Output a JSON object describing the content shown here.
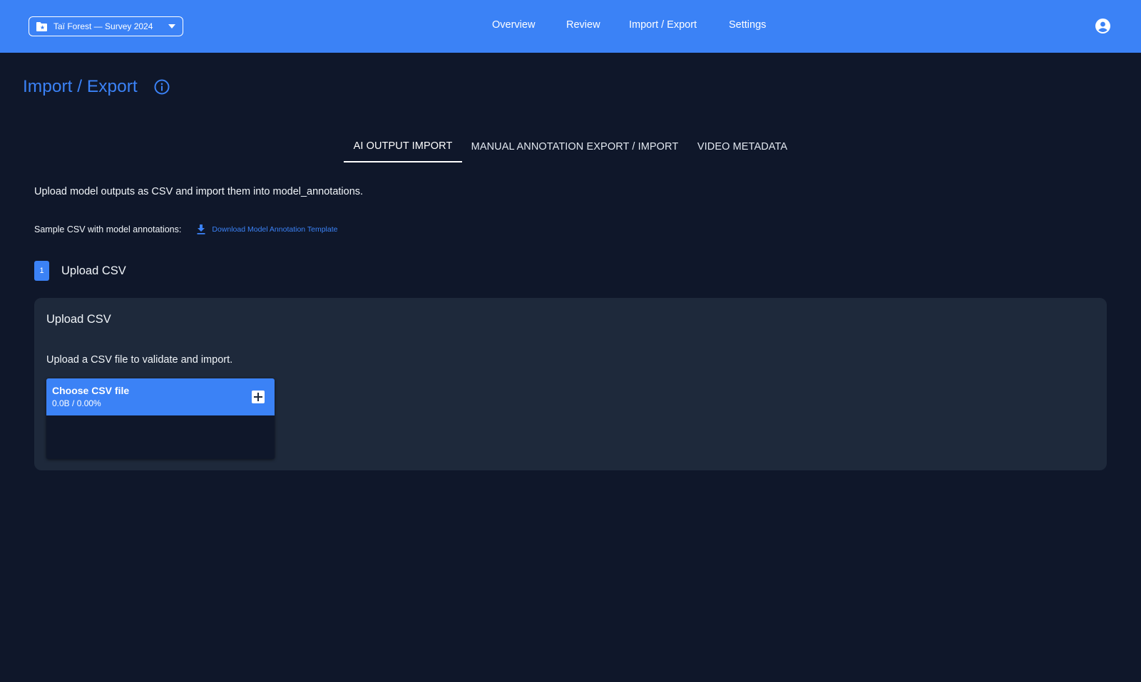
{
  "header": {
    "project_selector": {
      "label": "Taï Forest — Survey 2024"
    },
    "nav": [
      {
        "label": "Overview"
      },
      {
        "label": "Review"
      },
      {
        "label": "Import / Export"
      },
      {
        "label": "Settings"
      }
    ],
    "icons": {
      "project": "folder-star-icon",
      "dropdown": "caret-down-icon",
      "account": "account-circle-icon"
    }
  },
  "page": {
    "title": "Import / Export",
    "title_icon": "info-icon"
  },
  "tabs": [
    {
      "label": "AI OUTPUT IMPORT",
      "active": true
    },
    {
      "label": "MANUAL ANNOTATION EXPORT / IMPORT",
      "active": false
    },
    {
      "label": "VIDEO METADATA",
      "active": false
    }
  ],
  "content": {
    "intro": "Upload model outputs as CSV and import them into model_annotations.",
    "sample_label": "Sample CSV with model annotations:",
    "download_link": "Download Model Annotation Template",
    "download_icon": "download-icon",
    "step": {
      "number": "1",
      "title": "Upload CSV"
    },
    "card": {
      "title": "Upload CSV",
      "description": "Upload a CSV file to validate and import.",
      "uploader": {
        "title": "Choose CSV file",
        "progress": "0.0B / 0.00%",
        "add_icon": "plus-icon"
      }
    }
  },
  "colors": {
    "header": "#3b82f6",
    "background": "#0f172a",
    "card": "#1e293b",
    "accent": "#3b82f6",
    "text": "#f1f5f9"
  }
}
